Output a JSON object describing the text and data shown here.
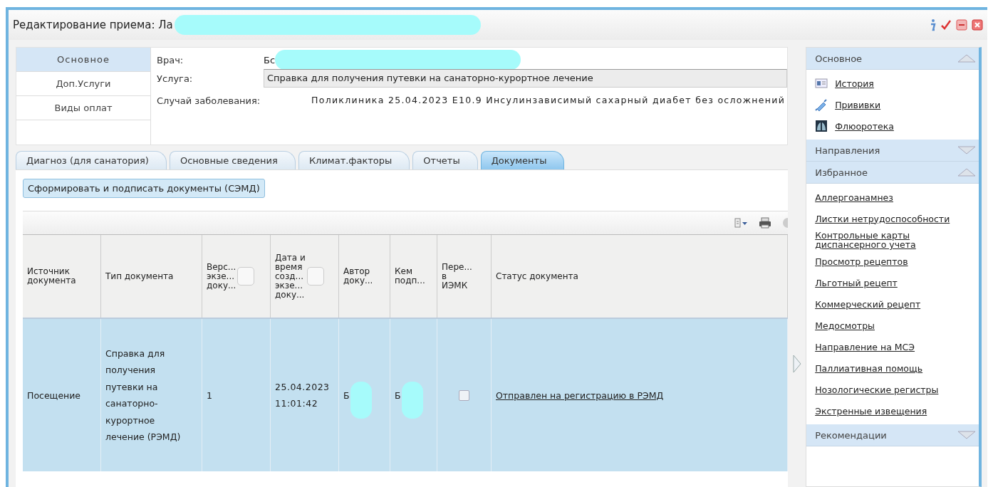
{
  "window": {
    "title": "Редактирование приема: Ла"
  },
  "nav": [
    {
      "label": "Основное",
      "selected": true
    },
    {
      "label": "Доп.Услуги",
      "selected": false
    },
    {
      "label": "Виды оплат",
      "selected": false
    }
  ],
  "form": {
    "doctor_label": "Врач:",
    "doctor_value": "Бс",
    "service_label": "Услуга:",
    "service_value": "Справка для получения путевки на санаторно-курортное лечение",
    "case_label": "Случай заболевания:",
    "case_value": "Поликлиника 25.04.2023 E10.9 Инсулинзависимый сахарный диабет без осложнений"
  },
  "tabs": [
    {
      "label": "Диагноз (для санатория)",
      "selected": false
    },
    {
      "label": "Основные сведения",
      "selected": false
    },
    {
      "label": "Климат.факторы",
      "selected": false
    },
    {
      "label": "Отчеты",
      "selected": false
    },
    {
      "label": "Документы",
      "selected": true
    }
  ],
  "action_button": "Сформировать и подписать документы (СЭМД)",
  "table": {
    "columns": [
      {
        "label": "Источник\nдокумента",
        "filter": false
      },
      {
        "label": "Тип документа",
        "filter": false
      },
      {
        "label": "Верс...\nэкзе...\nдоку...",
        "filter": true
      },
      {
        "label": "Дата и\nвремя\nсозд...\nэкзе...\nдоку...",
        "filter": true
      },
      {
        "label": "Автор\nдоку...",
        "filter": false
      },
      {
        "label": "Кем\nподп...",
        "filter": false
      },
      {
        "label": "Пере...\nв\nИЭМК",
        "filter": false
      },
      {
        "label": "Статус документа",
        "filter": false
      }
    ],
    "rows": [
      {
        "selected": true,
        "source": "Посещение",
        "type": "Справка для получения путевки на санаторно-курортное лечение (РЭМД)",
        "version": "1",
        "created": "25.04.2023 11:01:42",
        "author": "Б",
        "signer": "Б",
        "transferred": false,
        "status": "Отправлен на регистрацию в РЭМД"
      }
    ]
  },
  "sidebar": [
    {
      "title": "Основное",
      "expanded": true,
      "items": [
        {
          "label": "История",
          "kind": "history"
        },
        {
          "label": "Прививки",
          "kind": "vaccine"
        },
        {
          "label": "Флюоротека",
          "kind": "xray"
        }
      ]
    },
    {
      "title": "Направления",
      "expanded": false
    },
    {
      "title": "Избранное",
      "expanded": true,
      "items": [
        {
          "label": "Аллергоанамнез",
          "kind": "plain"
        },
        {
          "label": "Листки нетрудоспособности",
          "kind": "plain"
        },
        {
          "label": "Контрольные карты диспансерного учета",
          "kind": "plain"
        },
        {
          "label": "Просмотр рецептов",
          "kind": "plain"
        },
        {
          "label": "Льготный рецепт",
          "kind": "plain"
        },
        {
          "label": "Коммерческий рецепт",
          "kind": "plain"
        },
        {
          "label": "Медосмотры",
          "kind": "plain"
        },
        {
          "label": "Направление на МСЭ",
          "kind": "plain"
        },
        {
          "label": "Паллиативная помощь",
          "kind": "plain"
        },
        {
          "label": "Нозологические регистры",
          "kind": "plain"
        },
        {
          "label": "Экстренные извещения",
          "kind": "plain"
        }
      ]
    },
    {
      "title": "Рекомендации",
      "expanded": false
    }
  ]
}
